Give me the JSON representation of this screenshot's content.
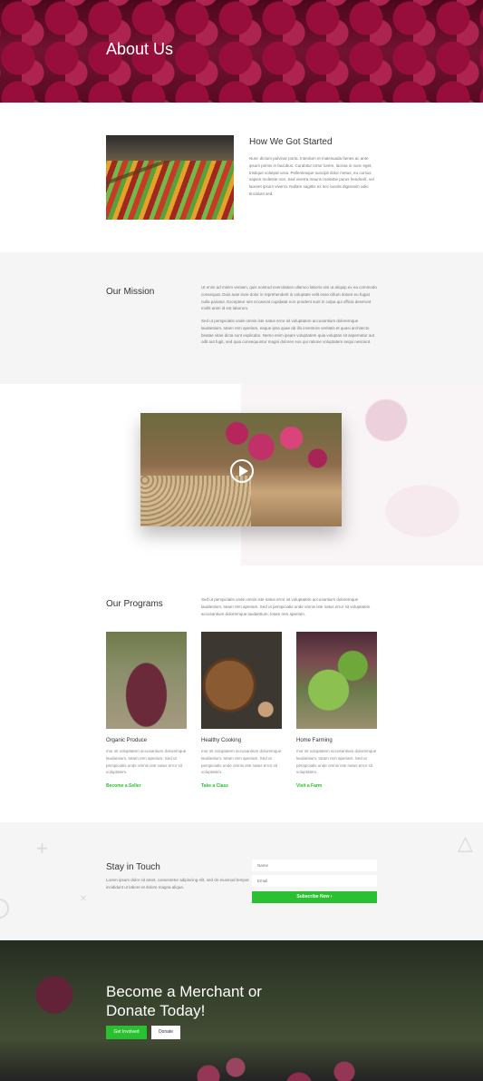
{
  "hero": {
    "title": "About Us"
  },
  "started": {
    "heading": "How We Got Started",
    "body": "Nunc dictum pulvinar porta. Interdum et malesuada fames ac ante ipsum primis in faucibus. Curabitur tortor lorem, lacinia in nunc eget, tristique volutpat urna. Pellentesque suscipit dolor metus, eu cursus sapien molestie non. Sed viverra mauris molestie purus hendrerit, vel laoreet ipsum viverra. Nullam sagittis ex nec iaculis dignissim odio tincidunt sed."
  },
  "mission": {
    "heading": "Our Mission",
    "p1": "Ut enim ad minim veniam, quis nostrud exercitation ullamco laboris nisi ut aliquip ex ea commodo consequat. Duis aute irure dolor in reprehenderit in voluptate velit esse cillum dolore eu fugiat nulla pariatur. Excepteur sint occaecat cupidatat non proident sunt in culpa qui officia deserunt mollit anim id est laborum.",
    "p2": "Sed ut perspiciatis unde omnis iste natus error sit voluptatem accusantium doloremque laudantium, totam rem aperiam, eaque ipsa quae ab illo inventore veritatis et quasi architecto beatae vitae dicta sunt explicabo. Nemo enim ipsam voluptatem quia voluptas sit aspernatur aut odit aut fugit, sed quia consequuntur magni dolores eos qui ratione voluptatem sequi nesciunt."
  },
  "programs": {
    "heading": "Our Programs",
    "intro": "Sed ut perspiciatis unde omnis iste natus error sit voluptatem accusantium doloremque laudantium, totam rem aperiam. Sed ut perspiciatis unde omnis iste natus error sit voluptatem accusantium doloremque laudantium, totam rem aperiam.",
    "cards": [
      {
        "title": "Organic Produce",
        "text": "mor sit voluptatem accusantium doloremque laudantium, totam rem aperiam. Sed ut perspiciatis unde omnis iste natus error sit voluptatem.",
        "link": "Become a Seller"
      },
      {
        "title": "Healthy Cooking",
        "text": "mor sit voluptatem accusantium doloremque laudantium, totam rem aperiam. Sed ut perspiciatis unde omnis iste natus error sit voluptatem.",
        "link": "Take a Class"
      },
      {
        "title": "Home Farming",
        "text": "mor sit voluptatem accusantium doloremque laudantium, totam rem aperiam. Sed ut perspiciatis unde omnis iste natus error sit voluptatem.",
        "link": "Visit a Farm"
      }
    ]
  },
  "touch": {
    "heading": "Stay in Touch",
    "body": "Lorem ipsum dolor sit amet, consectetur adipiscing elit, sed do eiusmod tempor incididunt ut labore et dolore magna aliqua.",
    "name_placeholder": "Name",
    "email_placeholder": "Email",
    "subscribe_label": "Subscribe Now"
  },
  "cta": {
    "title": "Become a Merchant or Donate Today!",
    "primary_label": "Get Involved",
    "secondary_label": "Donate"
  },
  "colors": {
    "accent": "#29c12f",
    "section_gray": "#f5f5f5"
  }
}
